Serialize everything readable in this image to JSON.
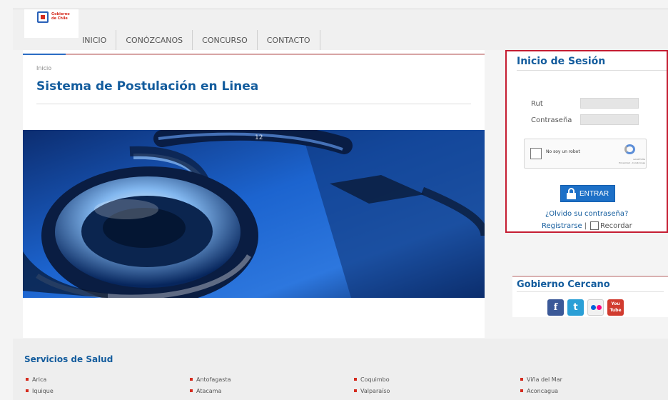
{
  "header": {
    "logo_text": "Gobierno de Chile",
    "nav": [
      "INICIO",
      "CONÓZCANOS",
      "CONCURSO",
      "CONTACTO"
    ]
  },
  "main": {
    "breadcrumb": "Inicio",
    "title": "Sistema de Postulación en Linea",
    "hero_number": "12"
  },
  "login": {
    "title": "Inicio de Sesión",
    "rut_label": "Rut",
    "rut_value": "",
    "password_label": "Contraseña",
    "password_value": "",
    "captcha_label": "No soy un robot",
    "captcha_brand": "reCAPTCHA",
    "captcha_terms": "Privacidad - Condiciones",
    "enter_label": "ENTRAR",
    "forgot_label": "¿Olvido su contraseña?",
    "register_label": "Registrarse",
    "separator": "|",
    "remember_label": "Recordar"
  },
  "social": {
    "title": "Gobierno Cercano",
    "facebook": "f",
    "twitter": "t",
    "youtube": "You Tube"
  },
  "footer": {
    "title": "Servicios de Salud",
    "services": [
      [
        "Arica",
        "Iquique"
      ],
      [
        "Antofagasta",
        "Atacama"
      ],
      [
        "Coquimbo",
        "Valparaíso"
      ],
      [
        "Viña del Mar",
        "Aconcagua"
      ]
    ]
  },
  "colors": {
    "accent": "#135c9d",
    "brand_red": "#c51d32",
    "button_blue": "#1d70c7"
  }
}
